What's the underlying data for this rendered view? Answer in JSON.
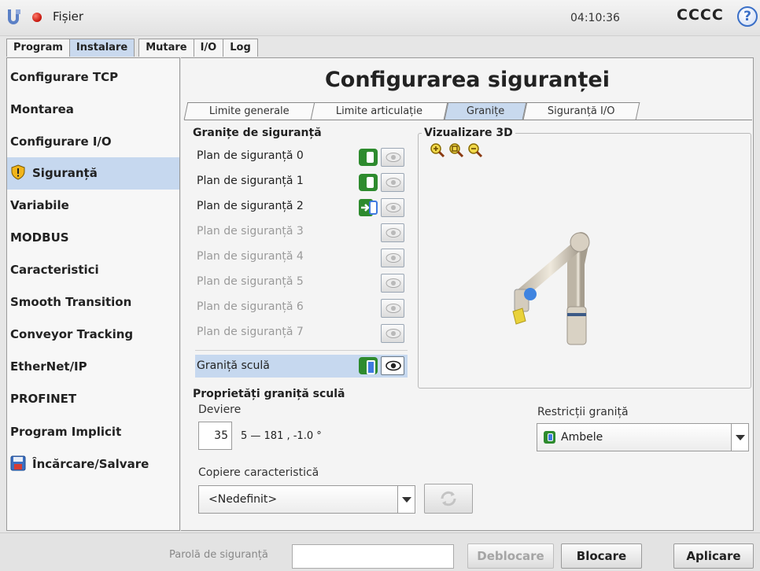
{
  "topbar": {
    "file_menu": "Fișier",
    "clock": "04:10:36",
    "robot_name": "CCCC",
    "help": "?"
  },
  "main_tabs": [
    "Program",
    "Instalare",
    "Mutare",
    "I/O",
    "Log"
  ],
  "sidebar": {
    "items": [
      {
        "label": "Configurare TCP"
      },
      {
        "label": "Montarea"
      },
      {
        "label": "Configurare I/O"
      },
      {
        "label": "Siguranță"
      },
      {
        "label": "Variabile"
      },
      {
        "label": "MODBUS"
      },
      {
        "label": "Caracteristici"
      },
      {
        "label": "Smooth Transition"
      },
      {
        "label": "Conveyor Tracking"
      },
      {
        "label": "EtherNet/IP"
      },
      {
        "label": "PROFINET"
      },
      {
        "label": "Program Implicit"
      },
      {
        "label": "Încărcare/Salvare"
      }
    ]
  },
  "page": {
    "title": "Configurarea siguranței",
    "tabs": [
      "Limite generale",
      "Limite articulație",
      "Granițe",
      "Siguranță I/O"
    ]
  },
  "boundaries": {
    "title": "Granițe de siguranță",
    "planes": [
      "Plan de siguranță 0",
      "Plan de siguranță 1",
      "Plan de siguranță 2",
      "Plan de siguranță 3",
      "Plan de siguranță 4",
      "Plan de siguranță 5",
      "Plan de siguranță 6",
      "Plan de siguranță 7"
    ],
    "tool_boundary": "Graniță sculă"
  },
  "viz": {
    "title": "Vizualizare 3D"
  },
  "tool_props": {
    "title": "Proprietăți graniță sculă",
    "deviation_label": "Deviere",
    "deviation_value": "35",
    "deviation_range": "5 — 181 , -1.0 °",
    "restriction_label": "Restricții graniță",
    "restriction_value": "Ambele",
    "copy_label": "Copiere caracteristică",
    "copy_value": "<Nedefinit>"
  },
  "bottom": {
    "password_label": "Parolă de siguranță",
    "unlock": "Deblocare",
    "lock": "Blocare",
    "apply": "Aplicare"
  }
}
